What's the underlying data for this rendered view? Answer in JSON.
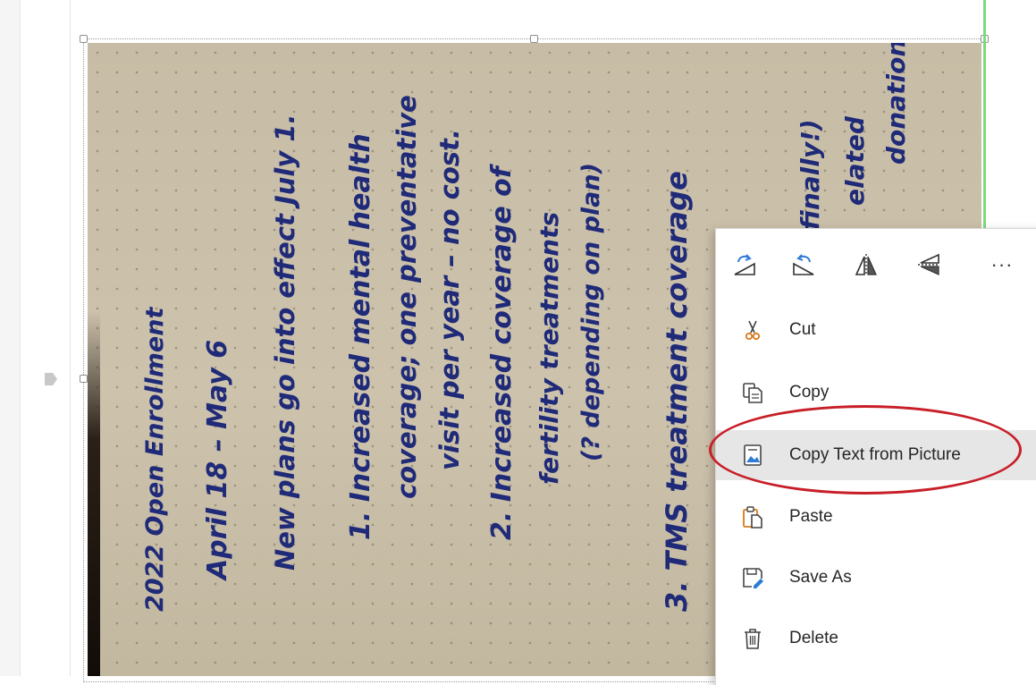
{
  "note": {
    "lines": [
      "2022 Open Enrollment",
      "April 18 – May 6",
      "New plans go into effect July 1.",
      "1. Increased mental health",
      "coverage; one preventative",
      "visit per year – no cost.",
      "2. Increased coverage of",
      "fertility treatments",
      "(? depending on plan)",
      "3. TMS treatment coverage",
      "(finally!)",
      "elated",
      "donation."
    ]
  },
  "toolbar": {
    "rotate_right_icon": "rotate-right-icon",
    "rotate_left_icon": "rotate-left-icon",
    "flip_vertical_icon": "flip-vertical-icon",
    "flip_horizontal_icon": "flip-horizontal-icon",
    "more_label": "···"
  },
  "menu": {
    "items": [
      {
        "label": "Cut",
        "icon": "scissors-icon",
        "selected": false
      },
      {
        "label": "Copy",
        "icon": "copy-icon",
        "selected": false
      },
      {
        "label": "Copy Text from Picture",
        "icon": "copy-text-from-picture-icon",
        "selected": true
      },
      {
        "label": "Paste",
        "icon": "paste-icon",
        "selected": false
      },
      {
        "label": "Save As",
        "icon": "save-as-icon",
        "selected": false
      },
      {
        "label": "Delete",
        "icon": "trash-icon",
        "selected": false
      }
    ]
  },
  "colors": {
    "accent_orange": "#d87a1a",
    "accent_blue": "#2f7bd6",
    "callout_red": "#c81e28",
    "ink_blue": "#1f2a78"
  }
}
